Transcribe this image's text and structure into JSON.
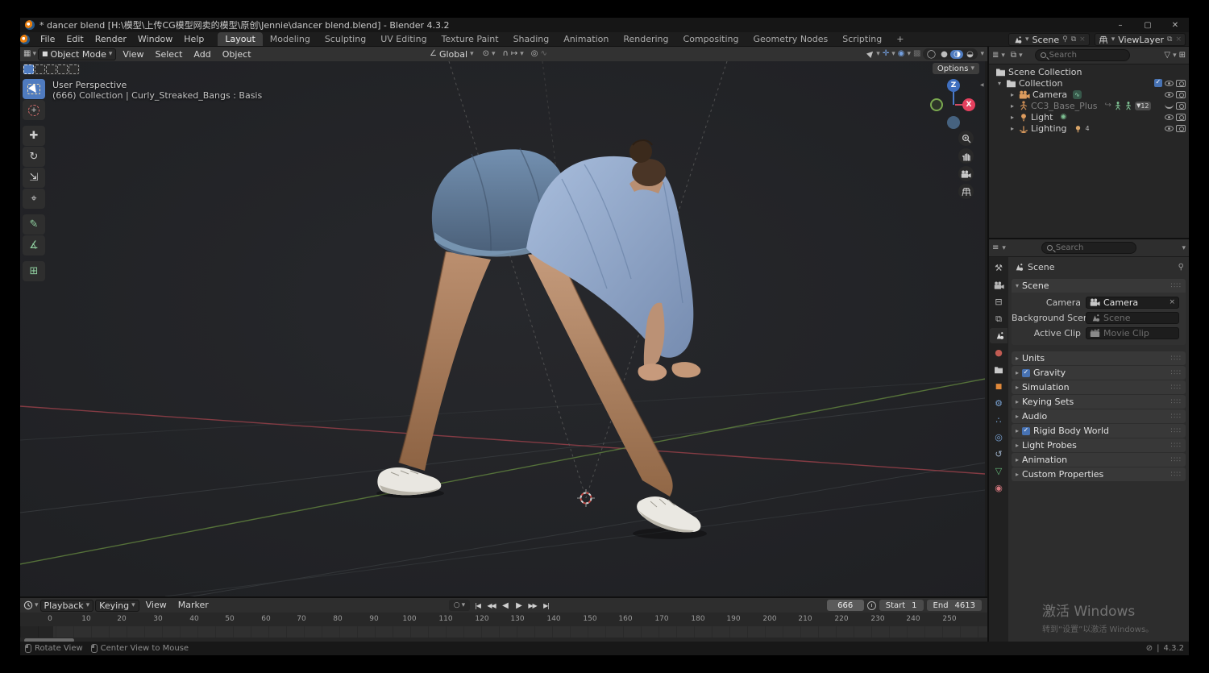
{
  "window": {
    "title": "* dancer blend [H:\\模型\\上传CG模型网卖的模型\\原创\\Jennie\\dancer blend.blend] - Blender 4.3.2",
    "controls": {
      "minimize": "–",
      "maximize": "▢",
      "close": "✕"
    }
  },
  "topbar": {
    "menus": [
      "File",
      "Edit",
      "Render",
      "Window",
      "Help"
    ],
    "workspaces": [
      "Layout",
      "Modeling",
      "Sculpting",
      "UV Editing",
      "Texture Paint",
      "Shading",
      "Animation",
      "Rendering",
      "Compositing",
      "Geometry Nodes",
      "Scripting"
    ],
    "add_workspace": "+",
    "scene_field": "Scene",
    "viewlayer_field": "ViewLayer"
  },
  "viewport": {
    "header": {
      "mode": "Object Mode",
      "menus": [
        "View",
        "Select",
        "Add",
        "Object"
      ],
      "orientation": "Global",
      "options": "Options"
    },
    "overlay": {
      "line1": "User Perspective",
      "line2": "(666) Collection | Curly_Streaked_Bangs : Basis"
    },
    "gizmo": {
      "x": "X",
      "z": "Z"
    }
  },
  "outliner": {
    "search_placeholder": "Search",
    "rows": [
      {
        "label": "Scene Collection"
      },
      {
        "label": "Collection"
      },
      {
        "label": "Camera"
      },
      {
        "label": "CC3_Base_Plus",
        "badge": "12"
      },
      {
        "label": "Light"
      },
      {
        "label": "Lighting",
        "badge": "4"
      }
    ]
  },
  "properties": {
    "search_placeholder": "Search",
    "breadcrumb": "Scene",
    "scene_panel": {
      "title": "Scene",
      "camera_label": "Camera",
      "camera_value": "Camera",
      "background_label": "Background Scene",
      "background_placeholder": "Scene",
      "clip_label": "Active Clip",
      "clip_placeholder": "Movie Clip"
    },
    "panels": [
      {
        "title": "Units"
      },
      {
        "title": "Gravity"
      },
      {
        "title": "Simulation"
      },
      {
        "title": "Keying Sets"
      },
      {
        "title": "Audio"
      },
      {
        "title": "Rigid Body World"
      },
      {
        "title": "Light Probes"
      },
      {
        "title": "Animation"
      },
      {
        "title": "Custom Properties"
      }
    ]
  },
  "timeline": {
    "menus": [
      "Playback",
      "Keying",
      "View",
      "Marker"
    ],
    "current_frame": "666",
    "start_label": "Start",
    "start_value": "1",
    "end_label": "End",
    "end_value": "4613",
    "ticks": [
      "0",
      "10",
      "20",
      "30",
      "40",
      "50",
      "60",
      "70",
      "80",
      "90",
      "100",
      "110",
      "120",
      "130",
      "140",
      "150",
      "160",
      "170",
      "180",
      "190",
      "200",
      "210",
      "220",
      "230",
      "240",
      "250"
    ]
  },
  "statusbar": {
    "hint1": "Rotate View",
    "hint2": "Center View to Mouse",
    "version": "4.3.2"
  },
  "watermark": {
    "line1": "激活 Windows",
    "line2": "转到“设置”以激活 Windows。"
  },
  "icons": {
    "dropdown": "▾",
    "chev_r": "▸",
    "chev_d": "▾",
    "close_x": "×",
    "pin": "⚲",
    "copy": "⧉",
    "jump_start": "|◀",
    "key_prev": "◀◀",
    "play_rev": "◀",
    "play": "▶",
    "key_next": "▶▶",
    "jump_end": "▶|",
    "autokey": "○",
    "tool_move": "✚",
    "tool_rotate": "↻",
    "tool_scale": "⇲",
    "tool_transform": "⌖",
    "tool_annotate": "✎",
    "tool_measure": "∡",
    "tool_addcube": "⊞",
    "orientation": "∠",
    "pivot": "⊙",
    "magnet": "∩",
    "snap_to": "↦",
    "prop_edit": "◎",
    "falloff": "∿",
    "gizmo_toggle": "✛",
    "overlays": "◉",
    "xray": "▩",
    "shade_wire": "◯",
    "shade_solid": "●",
    "shade_material": "◑",
    "shade_rendered": "◒",
    "anim_badge": "∿",
    "constraint_badge": "↪",
    "tri_badge": "▼",
    "light_badge": "◉",
    "tab_tool": "⚒",
    "tab_output": "⊟",
    "tab_viewlayer": "⧉",
    "tab_world": "●",
    "tab_object": "■",
    "tab_modifier": "⚙",
    "tab_particles": "∴",
    "tab_physics": "◎",
    "tab_constraint": "↺",
    "tab_data": "▽",
    "tab_material": "◉",
    "offline": "⊘",
    "divider": "|",
    "plus": "+",
    "cursor_plus": "+",
    "list_icon": "≣",
    "grid_icon": "▦",
    "props_icon": "≡",
    "clock_caret": "▾"
  }
}
